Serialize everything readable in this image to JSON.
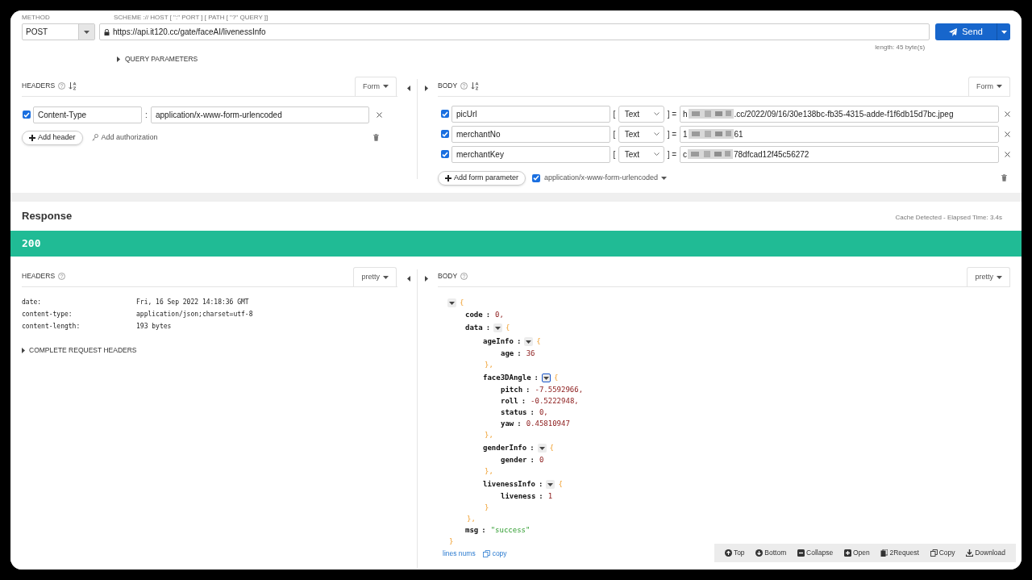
{
  "request": {
    "method_label": "METHOD",
    "url_label": "SCHEME :// HOST [ \":\" PORT ] [ PATH [ \"?\" QUERY ]]",
    "method": "POST",
    "url": "https://api.it120.cc/gate/faceAI/livenessInfo",
    "send": "Send",
    "length": "length: 45 byte(s)",
    "query_parameters": "QUERY PARAMETERS",
    "headers": {
      "title": "HEADERS",
      "mode": "Form",
      "rows": [
        {
          "checked": true,
          "name": "Content-Type",
          "sep": ":",
          "value": "application/x-www-form-urlencoded"
        }
      ],
      "add": "Add header",
      "auth": "Add authorization"
    },
    "body": {
      "title": "BODY",
      "mode": "Form",
      "rows": [
        {
          "checked": true,
          "name": "picUrl",
          "open": "[",
          "type": "Text",
          "close": "] =",
          "value_start": "h",
          "value_end": ".cc/2022/09/16/30e138bc-fb35-4315-adde-f1f6db15d7bc.jpeg",
          "redacted": true
        },
        {
          "checked": true,
          "name": "merchantNo",
          "open": "[",
          "type": "Text",
          "close": "] =",
          "value_start": "1",
          "value_end": "61",
          "redacted": true
        },
        {
          "checked": true,
          "name": "merchantKey",
          "open": "[",
          "type": "Text",
          "close": "] =",
          "value_start": "c",
          "value_end": "78dfcad12f45c56272",
          "redacted": true
        }
      ],
      "add": "Add form parameter",
      "encoding_checked": true,
      "encoding": "application/x-www-form-urlencoded"
    }
  },
  "response": {
    "title": "Response",
    "meta": "Cache Detected - Elapsed Time: 3.4s",
    "status": "200",
    "headers": {
      "title": "HEADERS",
      "mode": "pretty",
      "rows": [
        {
          "name": "date:",
          "value": "Fri, 16 Sep 2022 14:18:36 GMT"
        },
        {
          "name": "content-type:",
          "value": "application/json;charset=utf-8"
        },
        {
          "name": "content-length:",
          "value": "193 bytes"
        }
      ],
      "complete": "COMPLETE REQUEST HEADERS"
    },
    "body": {
      "title": "BODY",
      "mode": "pretty",
      "separator": ":",
      "tree": {
        "kind": "object",
        "open": "{",
        "close": "}",
        "focused": false,
        "children": [
          {
            "kind": "number",
            "key": "code",
            "value": "0,"
          },
          {
            "kind": "object",
            "key": "data",
            "open": "{",
            "close": "},",
            "focused": false,
            "children": [
              {
                "kind": "object",
                "key": "ageInfo",
                "open": "{",
                "close": "},",
                "focused": false,
                "children": [
                  {
                    "kind": "number",
                    "key": "age",
                    "value": "36"
                  }
                ]
              },
              {
                "kind": "object",
                "key": "face3DAngle",
                "open": "{",
                "close": "},",
                "focused": true,
                "children": [
                  {
                    "kind": "number",
                    "key": "pitch",
                    "value": "-7.5592966,"
                  },
                  {
                    "kind": "number",
                    "key": "roll",
                    "value": "-0.5222948,"
                  },
                  {
                    "kind": "number",
                    "key": "status",
                    "value": "0,"
                  },
                  {
                    "kind": "number",
                    "key": "yaw",
                    "value": "0.45810947"
                  }
                ]
              },
              {
                "kind": "object",
                "key": "genderInfo",
                "open": "{",
                "close": "},",
                "focused": false,
                "children": [
                  {
                    "kind": "number",
                    "key": "gender",
                    "value": "0"
                  }
                ]
              },
              {
                "kind": "object",
                "key": "livenessInfo",
                "open": "{",
                "close": "}",
                "focused": false,
                "children": [
                  {
                    "kind": "number",
                    "key": "liveness",
                    "value": "1"
                  }
                ]
              }
            ]
          },
          {
            "kind": "string",
            "key": "msg",
            "value": "\"success\""
          }
        ]
      },
      "links": [
        {
          "kind": "lines",
          "label": "lines nums"
        },
        {
          "kind": "copy",
          "label": "copy"
        }
      ],
      "toolbar": [
        {
          "kind": "top",
          "label": "Top"
        },
        {
          "kind": "bottom",
          "label": "Bottom"
        },
        {
          "kind": "collapse",
          "label": "Collapse"
        },
        {
          "kind": "open",
          "label": "Open"
        },
        {
          "kind": "request",
          "label": "2Request"
        },
        {
          "kind": "copy",
          "label": "Copy"
        },
        {
          "kind": "download",
          "label": "Download"
        }
      ]
    }
  }
}
